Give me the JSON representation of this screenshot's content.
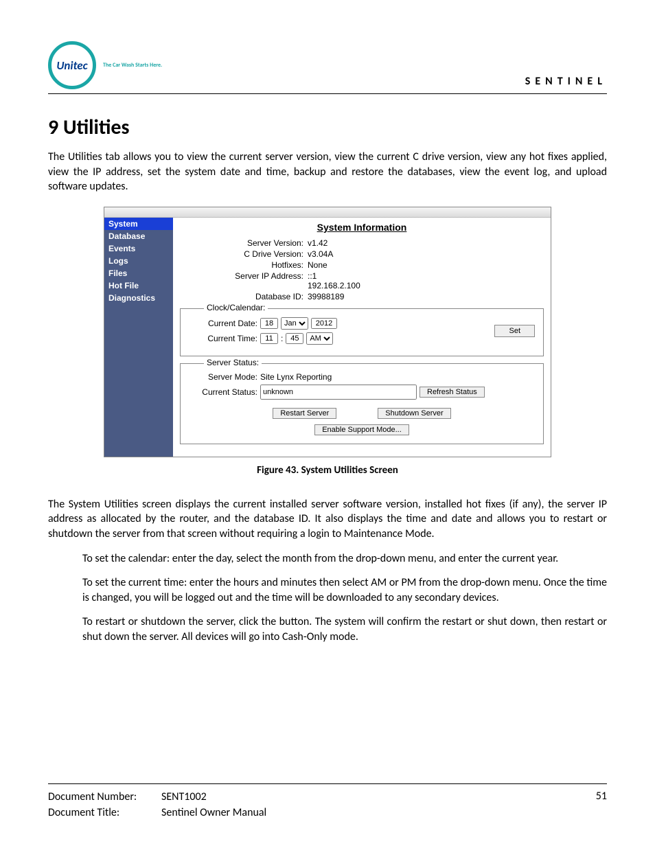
{
  "header": {
    "logo_text": "Unitec",
    "logo_tagline": "The Car Wash Starts Here.",
    "brand_right": "SENTINEL"
  },
  "section": {
    "heading": "9  Utilities",
    "intro": "The Utilities tab allows you to view the current server version, view the current C drive version, view any hot fixes applied, view the IP address, set the system date and time, backup and restore the databases, view the event log, and upload software updates.",
    "figure_caption": "Figure 43. System Utilities Screen",
    "para2": "The System Utilities screen displays the current installed server software version, installed hot fixes (if any), the server IP address as allocated by the router, and the database ID. It also displays the time and date and allows you to restart or shutdown the server from that screen without requiring a login to Maintenance Mode.",
    "para3": "To set the calendar: enter the day, select the month from the drop-down menu, and enter the current year.",
    "para4": "To set the current time: enter the hours and minutes then select AM or PM from the drop-down menu. Once the time is changed, you will be logged out and the time will be downloaded to any secondary devices.",
    "para5": "To restart or shutdown the server, click the button. The system will confirm the restart or shut down, then restart or shut down the server.  All devices will go into Cash-Only mode."
  },
  "app": {
    "sidebar": [
      "System",
      "Database",
      "Events",
      "Logs",
      "Files",
      "Hot File",
      "Diagnostics"
    ],
    "title": "System Information",
    "info": {
      "server_version_label": "Server Version:",
      "server_version": "v1.42",
      "cdrive_label": "C Drive Version:",
      "cdrive": "v3.04A",
      "hotfixes_label": "Hotfixes:",
      "hotfixes": "None",
      "ip_label": "Server IP Address:",
      "ip1": "::1",
      "ip2": "192.168.2.100",
      "dbid_label": "Database ID:",
      "dbid": "39988189"
    },
    "clock": {
      "legend": "Clock/Calendar:",
      "date_label": "Current Date:",
      "day": "18",
      "month": "Jan",
      "year": "2012",
      "time_label": "Current Time:",
      "hour": "11",
      "min": "45",
      "ampm": "AM",
      "set_btn": "Set"
    },
    "status": {
      "legend": "Server Status:",
      "mode_label": "Server Mode:",
      "mode": "Site Lynx Reporting",
      "status_label": "Current Status:",
      "status_value": "unknown",
      "refresh_btn": "Refresh Status",
      "restart_btn": "Restart Server",
      "shutdown_btn": "Shutdown Server",
      "support_btn": "Enable Support Mode..."
    }
  },
  "footer": {
    "docnum_label": "Document Number:",
    "docnum": "SENT1002",
    "title_label": "Document Title:",
    "title": "Sentinel Owner Manual",
    "page": "51"
  }
}
